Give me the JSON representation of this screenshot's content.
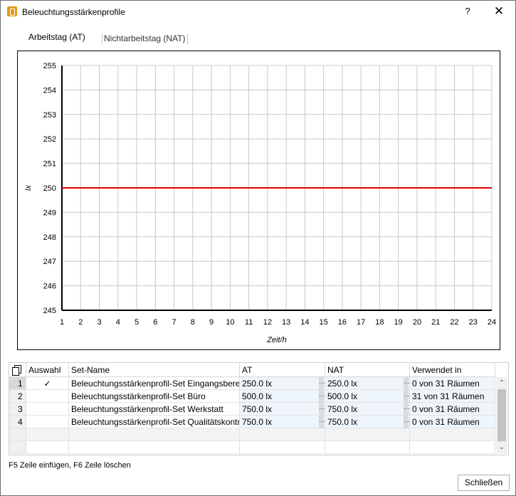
{
  "window": {
    "title": "Beleuchtungsstärkenprofile",
    "help_label": "?",
    "close_label": "✕"
  },
  "tabs": [
    {
      "label": "Arbeitstag (AT)",
      "selected": true
    },
    {
      "label": "Nichtarbeitstag (NAT)",
      "selected": false
    }
  ],
  "chart_data": {
    "type": "line",
    "xlabel": "Zeit/h",
    "ylabel": "lx",
    "xlim": [
      1,
      24
    ],
    "ylim": [
      245,
      255
    ],
    "x_ticks": [
      "1",
      "2",
      "3",
      "4",
      "5",
      "6",
      "7",
      "8",
      "9",
      "10",
      "11",
      "12",
      "13",
      "14",
      "15",
      "16",
      "17",
      "18",
      "19",
      "20",
      "21",
      "22",
      "23",
      "24"
    ],
    "y_ticks": [
      "245",
      "246",
      "247",
      "248",
      "249",
      "250",
      "251",
      "252",
      "253",
      "254",
      "255"
    ],
    "grid": true,
    "series": [
      {
        "x": [
          1,
          24
        ],
        "values": [
          250,
          250
        ],
        "color": "#e00000"
      }
    ]
  },
  "table": {
    "columns": [
      "Auswahl",
      "Set-Name",
      "AT",
      "NAT",
      "Verwendet in"
    ],
    "rows": [
      {
        "num": "1",
        "check": "✓",
        "name": "Beleuchtungsstärkenprofil-Set Eingangsbereich",
        "at": "250.0 lx",
        "nat": "250.0 lx",
        "used": "0 von 31 Räumen"
      },
      {
        "num": "2",
        "check": "",
        "name": "Beleuchtungsstärkenprofil-Set Büro",
        "at": "500.0 lx",
        "nat": "500.0 lx",
        "used": "31 von 31 Räumen"
      },
      {
        "num": "3",
        "check": "",
        "name": "Beleuchtungsstärkenprofil-Set Werkstatt",
        "at": "750.0 lx",
        "nat": "750.0 lx",
        "used": "0 von 31 Räumen"
      },
      {
        "num": "4",
        "check": "",
        "name": "Beleuchtungsstärkenprofil-Set Qualitätskontrolle",
        "at": "750.0 lx",
        "nat": "750.0 lx",
        "used": "0 von 31 Räumen"
      }
    ],
    "ellipsis": "···"
  },
  "footer": {
    "hint": "F5 Zeile einfügen, F6 Zeile löschen",
    "close_button": "Schließen"
  }
}
